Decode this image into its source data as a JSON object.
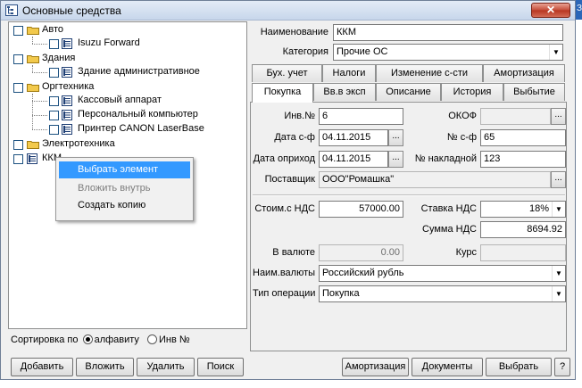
{
  "window": {
    "title": "Основные средства",
    "close_glyph": "✕",
    "edge_text": "Зг"
  },
  "tree": {
    "nodes": [
      {
        "label": "Авто",
        "icon": "folder-icon"
      },
      {
        "label": "Isuzu Forward",
        "icon": "item-icon"
      },
      {
        "label": "Здания",
        "icon": "folder-icon"
      },
      {
        "label": "Здание административное",
        "icon": "item-icon"
      },
      {
        "label": "Оргтехника",
        "icon": "folder-icon"
      },
      {
        "label": "Кассовый аппарат",
        "icon": "item-icon"
      },
      {
        "label": "Персональный компьютер",
        "icon": "item-icon"
      },
      {
        "label": "Принтер CANON LaserBase",
        "icon": "item-icon"
      },
      {
        "label": "Электротехника",
        "icon": "folder-icon"
      },
      {
        "label": "ККМ",
        "icon": "item-icon"
      }
    ]
  },
  "context_menu": {
    "items": [
      {
        "label": "Выбрать элемент",
        "state": "selected"
      },
      {
        "label": "Вложить внутрь",
        "state": "disabled"
      },
      {
        "label": "Создать копию",
        "state": "normal"
      }
    ]
  },
  "sort": {
    "label": "Сортировка по",
    "options": [
      "алфавиту",
      "Инв №"
    ],
    "selected": "алфавиту"
  },
  "left_buttons": [
    "Добавить",
    "Вложить",
    "Удалить",
    "Поиск"
  ],
  "header_form": {
    "name_label": "Наименование",
    "name_value": "ККМ",
    "category_label": "Категория",
    "category_value": "Прочие ОС"
  },
  "tabs_row1": [
    "Бух. учет",
    "Налоги",
    "Изменение с-сти",
    "Амортизация"
  ],
  "tabs_row2": [
    "Покупка",
    "Вв.в эксп",
    "Описание",
    "История",
    "Выбытие"
  ],
  "active_tab": "Покупка",
  "purchase": {
    "inv_label": "Инв.№",
    "inv_value": "6",
    "okof_label": "ОКОФ",
    "okof_value": "",
    "invoice_date_label": "Дата с-ф",
    "invoice_date": "04.11.2015",
    "invoice_no_label": "№ с-ф",
    "invoice_no": "65",
    "receipt_date_label": "Дата оприход",
    "receipt_date": "04.11.2015",
    "waybill_label": "№ накладной",
    "waybill_no": "123",
    "supplier_label": "Поставщик",
    "supplier": "ООО\"Ромашка\"",
    "cost_label": "Стоим.с НДС",
    "cost": "57000.00",
    "vat_rate_label": "Ставка НДС",
    "vat_rate": "18%",
    "vat_sum_label": "Сумма НДС",
    "vat_sum": "8694.92",
    "currency_amount_label": "В валюте",
    "currency_amount": "0.00",
    "rate_label": "Курс",
    "rate_value": "",
    "currency_name_label": "Наим.валюты",
    "currency_name": "Российский рубль",
    "operation_type_label": "Тип операции",
    "operation_type": "Покупка",
    "dots": "..."
  },
  "right_buttons": [
    "Амортизация",
    "Документы",
    "Выбрать",
    "?"
  ],
  "colors": {
    "selection": "#3399ff",
    "folder": "#f2c94c",
    "close": "#c44b37"
  }
}
